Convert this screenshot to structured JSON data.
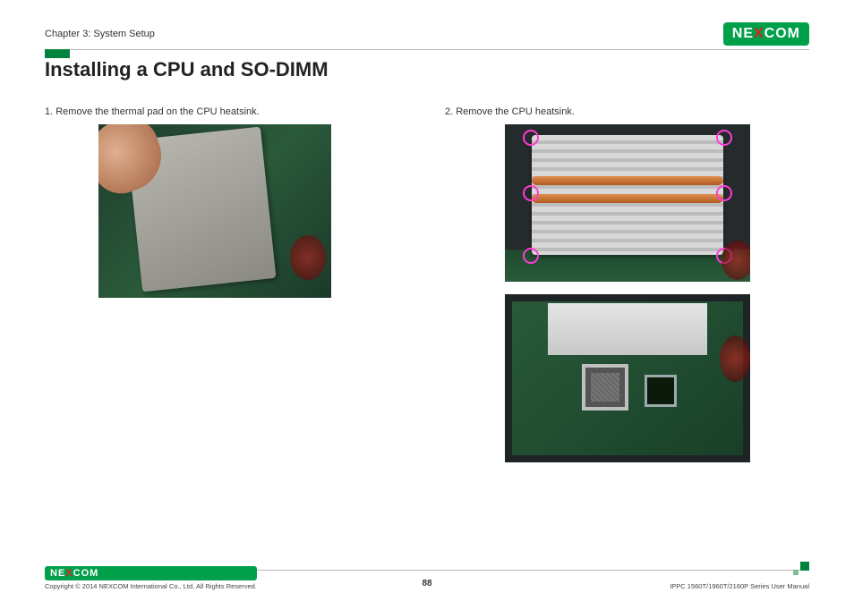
{
  "header": {
    "chapter": "Chapter 3: System Setup",
    "brand": "NEXCOM"
  },
  "title": "Installing a CPU and SO-DIMM",
  "steps": {
    "s1": "1. Remove the thermal pad on the CPU heatsink.",
    "s2": "2. Remove the CPU heatsink."
  },
  "footer": {
    "brand": "NEXCOM",
    "copyright": "Copyright © 2014 NEXCOM International Co., Ltd. All Rights Reserved.",
    "page": "88",
    "manual": "IPPC 1560T/1960T/2160P Series User Manual"
  }
}
